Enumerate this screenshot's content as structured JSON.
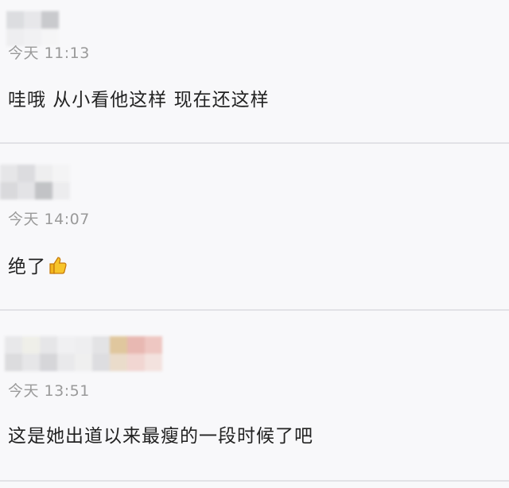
{
  "comments": [
    {
      "time": "今天 11:13",
      "text": "哇哦 从小看他这样 现在还这样",
      "mosaic": [
        [
          "#dcdde0",
          "#e7e7ea",
          "#c9cacd"
        ],
        [
          "#eeeef0",
          "#f1f1f3",
          "#f5f5f6"
        ]
      ]
    },
    {
      "time": "今天 14:07",
      "text": "绝了",
      "mosaic": [
        [
          "#e6e6e8",
          "#dcdcdf",
          "#eeeeef",
          "#f4f4f5"
        ],
        [
          "#d9d9dc",
          "#e3e3e6",
          "#c2c3c6",
          "#ececee"
        ]
      ]
    },
    {
      "time": "今天 13:51",
      "text": "这是她出道以来最瘦的一段时候了吧",
      "mosaic": [
        [
          "#e8e8ea",
          "#efefe9",
          "#e6e6e8",
          "#f0f0f2",
          "#eeeef0",
          "#e3e3e5",
          "#e0c79e",
          "#e8b8b2",
          "#eec7c2"
        ],
        [
          "#dcdcde",
          "#e6e6e8",
          "#d6d6d9",
          "#e9e9eb",
          "#efefef",
          "#dddde0",
          "#eadccb",
          "#f1d6d2",
          "#f3e2de"
        ]
      ]
    }
  ],
  "emoji": "thumbs-up-icon"
}
